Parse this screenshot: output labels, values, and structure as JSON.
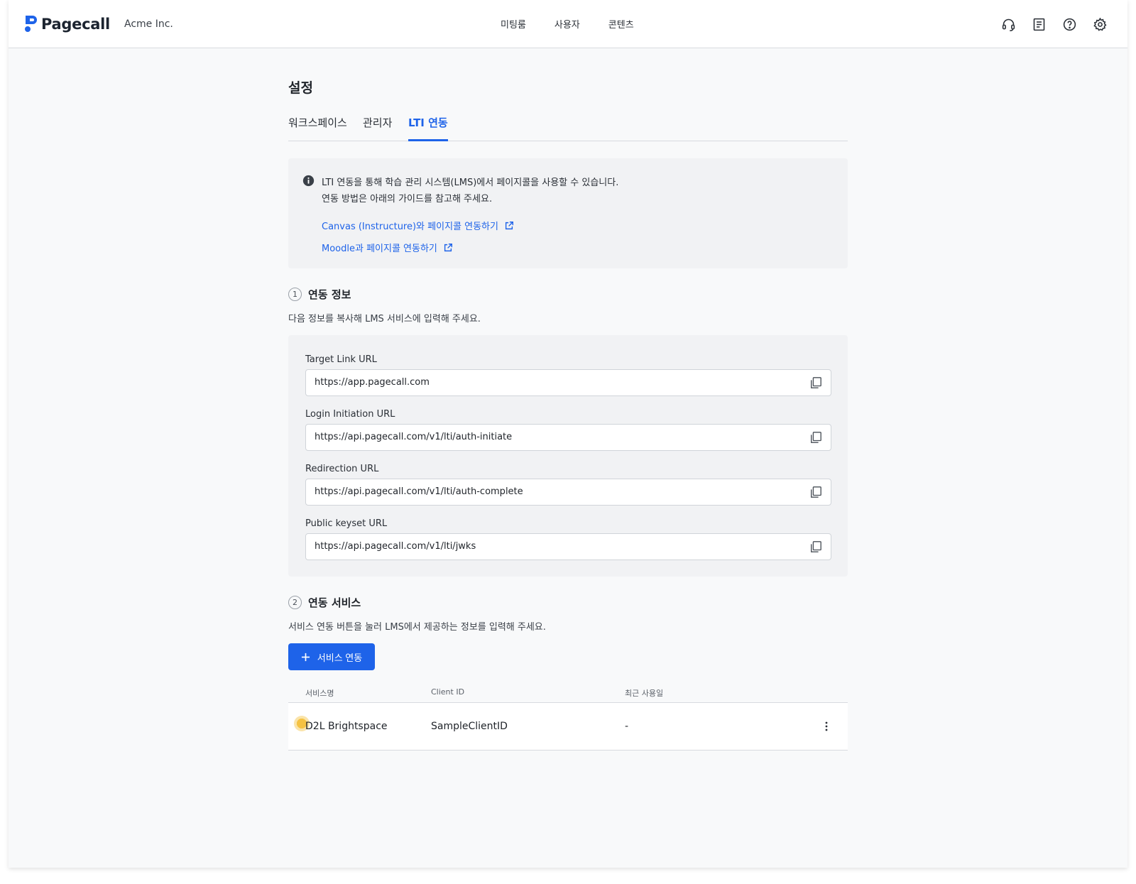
{
  "header": {
    "brand": "Pagecall",
    "workspace": "Acme Inc.",
    "nav": [
      "미팅룸",
      "사용자",
      "콘텐츠"
    ],
    "icons": [
      "headset-icon",
      "document-icon",
      "help-icon",
      "settings-icon"
    ]
  },
  "page": {
    "title": "설정",
    "tabs": [
      {
        "label": "워크스페이스",
        "active": false
      },
      {
        "label": "관리자",
        "active": false
      },
      {
        "label": "LTI 연동",
        "active": true
      }
    ]
  },
  "info": {
    "line1": "LTI 연동을 통해 학습 관리 시스템(LMS)에서 페이지콜을 사용할 수 있습니다.",
    "line2": "연동 방법은 아래의 가이드를 참고해 주세요.",
    "links": [
      "Canvas (Instructure)와 페이지콜 연동하기",
      "Moodle과 페이지콜 연동하기"
    ]
  },
  "section1": {
    "number": "1",
    "title": "연동 정보",
    "description": "다음 정보를 복사해 LMS 서비스에 입력해 주세요.",
    "fields": [
      {
        "label": "Target Link URL",
        "value": "https://app.pagecall.com"
      },
      {
        "label": "Login Initiation URL",
        "value": "https://api.pagecall.com/v1/lti/auth-initiate"
      },
      {
        "label": "Redirection URL",
        "value": "https://api.pagecall.com/v1/lti/auth-complete"
      },
      {
        "label": "Public keyset URL",
        "value": "https://api.pagecall.com/v1/lti/jwks"
      }
    ]
  },
  "section2": {
    "number": "2",
    "title": "연동 서비스",
    "description": "서비스 연동 버튼을 눌러 LMS에서 제공하는 정보를 입력해 주세요.",
    "button_label": "서비스 연동",
    "columns": [
      "서비스명",
      "Client ID",
      "최근 사용일"
    ],
    "rows": [
      {
        "service": "D2L Brightspace",
        "client_id": "SampleClientID",
        "last_used": "-"
      }
    ]
  },
  "colors": {
    "accent": "#1e63e9",
    "background": "#f8f9fa",
    "panel": "#f1f2f4"
  }
}
